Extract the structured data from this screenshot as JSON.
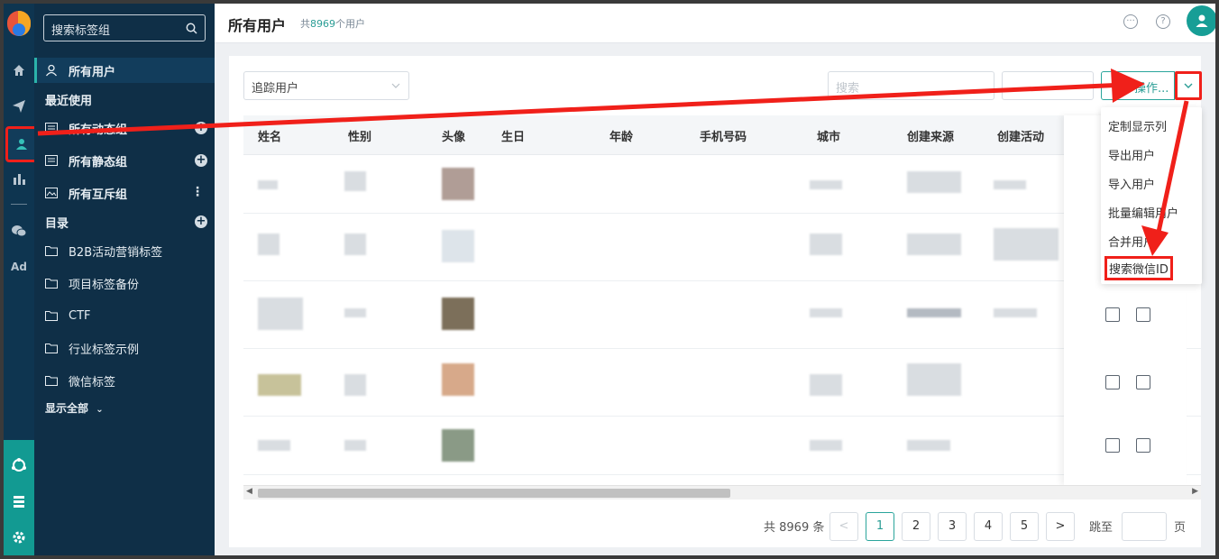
{
  "sidebar": {
    "search_placeholder": "搜索标签组",
    "all_users": "所有用户",
    "recent_heading": "最近使用",
    "dynamic_groups": "所有动态组",
    "static_groups": "所有静态组",
    "exclusive_groups": "所有互斥组",
    "catalog_heading": "目录",
    "folders": [
      "B2B活动营销标签",
      "项目标签备份",
      "CTF",
      "行业标签示例",
      "微信标签"
    ],
    "show_all": "显示全部"
  },
  "rail": {
    "ad_label": "Ad"
  },
  "header": {
    "title": "所有用户",
    "subtitle_prefix": "共",
    "user_count": "8969",
    "subtitle_suffix": "个用户"
  },
  "toolbar": {
    "filter_value": "追踪用户",
    "search_placeholder": "搜索",
    "ops_label": "操作..."
  },
  "table": {
    "columns": [
      "姓名",
      "性别",
      "头像",
      "生日",
      "年龄",
      "手机号码",
      "城市",
      "创建来源",
      "创建活动"
    ]
  },
  "ops_menu": {
    "items": [
      "定制显示列",
      "导出用户",
      "导入用户",
      "批量编辑用户",
      "合并用户",
      "搜索微信ID"
    ]
  },
  "pagination": {
    "total_text": "共 8969 条",
    "pages": [
      "1",
      "2",
      "3",
      "4",
      "5"
    ],
    "current_page": "1",
    "jump_label": "跳至",
    "page_unit": "页"
  },
  "colors": {
    "accent": "#2a9d95",
    "sidebar_bg": "#0f2f47",
    "highlight": "#f0201a"
  }
}
